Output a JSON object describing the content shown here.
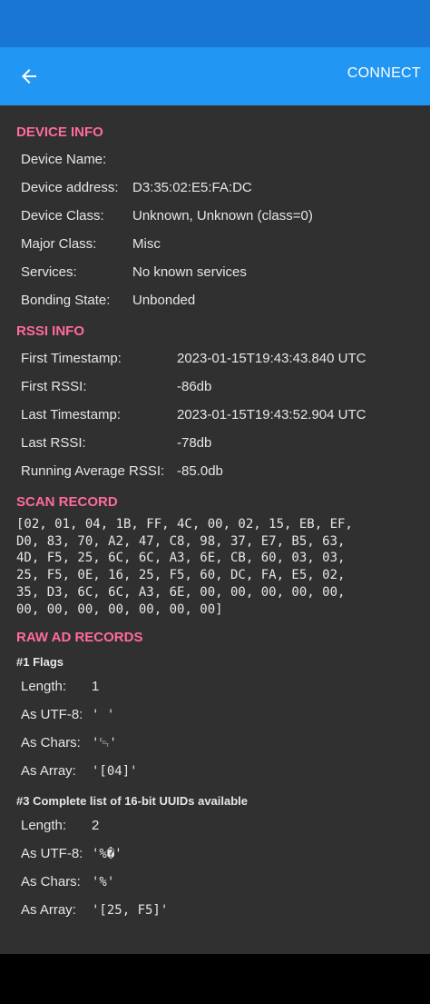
{
  "app_bar": {
    "connect_label": "CONNECT"
  },
  "device_info": {
    "title": "DEVICE INFO",
    "rows": [
      {
        "label": "Device Name:",
        "value": ""
      },
      {
        "label": "Device address:",
        "value": "D3:35:02:E5:FA:DC"
      },
      {
        "label": "Device Class:",
        "value": "Unknown, Unknown (class=0)"
      },
      {
        "label": "Major Class:",
        "value": "Misc"
      },
      {
        "label": "Services:",
        "value": "No known services"
      },
      {
        "label": "Bonding State:",
        "value": "Unbonded"
      }
    ]
  },
  "rssi_info": {
    "title": "RSSI INFO",
    "rows": [
      {
        "label": "First Timestamp:",
        "value": "2023-01-15T19:43:43.840 UTC"
      },
      {
        "label": "First RSSI:",
        "value": "-86db"
      },
      {
        "label": "Last Timestamp:",
        "value": "2023-01-15T19:43:52.904 UTC"
      },
      {
        "label": "Last RSSI:",
        "value": "-78db"
      },
      {
        "label": "Running Average RSSI:",
        "value": "-85.0db"
      }
    ]
  },
  "scan_record": {
    "title": "SCAN RECORD",
    "lines": [
      "[02, 01, 04, 1B, FF, 4C, 00, 02, 15, EB, EF,",
      "D0, 83, 70, A2, 47, C8, 98, 37, E7, B5, 63,",
      "4D, F5, 25, 6C, 6C, A3, 6E, CB, 60, 03, 03,",
      "25, F5, 0E, 16, 25, F5, 60, DC, FA, E5, 02,",
      "35, D3, 6C, 6C, A3, 6E, 00, 00, 00, 00, 00,",
      "00, 00, 00, 00, 00, 00, 00]"
    ]
  },
  "raw_ad_records": {
    "title": "RAW AD RECORDS",
    "records": [
      {
        "heading": "#1 Flags",
        "rows": [
          {
            "label": "Length:",
            "value": "1"
          },
          {
            "label": "As UTF-8:",
            "value": "' '"
          },
          {
            "label": "As Chars:",
            "value": "'␄'"
          },
          {
            "label": "As Array:",
            "value": "'[04]'"
          }
        ]
      },
      {
        "heading": "#3 Complete list of 16-bit UUIDs available",
        "rows": [
          {
            "label": "Length:",
            "value": "2"
          },
          {
            "label": "As UTF-8:",
            "value": "'%�'"
          },
          {
            "label": "As Chars:",
            "value": "'%'"
          },
          {
            "label": "As Array:",
            "value": "'[25, F5]'"
          }
        ]
      }
    ]
  }
}
